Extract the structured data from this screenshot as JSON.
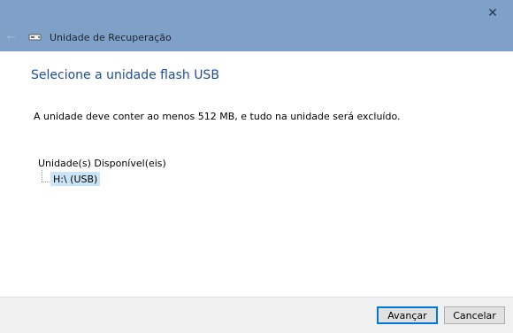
{
  "window": {
    "title": "Unidade de Recuperação",
    "close_glyph": "✕",
    "back_glyph": "←",
    "accent_color": "#7fa1c7"
  },
  "page": {
    "heading": "Selecione a unidade flash USB",
    "description": "A unidade deve conter ao menos 512 MB, e tudo na unidade será excluído.",
    "drives_label": "Unidade(s) Disponível(eis)",
    "drives": [
      {
        "label": "H:\\ (USB)",
        "selected": true
      }
    ]
  },
  "footer": {
    "next_label": "Avançar",
    "cancel_label": "Cancelar"
  }
}
